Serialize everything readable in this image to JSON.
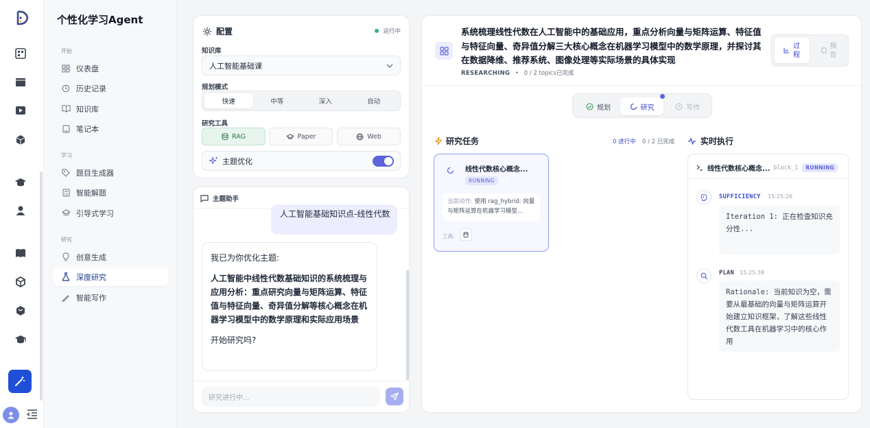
{
  "app": {
    "brand": "个性化学习Agent"
  },
  "rail": {
    "icons": [
      "logo-icon",
      "dashboard-icon",
      "video-icon",
      "play-icon",
      "cube-icon",
      "graduation-icon",
      "user-icon",
      "book-icon",
      "box-icon",
      "package-icon",
      "hat-icon",
      "wand-icon",
      "avatar",
      "collapse-icon"
    ]
  },
  "nav": {
    "sections": [
      {
        "title": "开始",
        "items": [
          {
            "label": "仪表盘",
            "icon": "dashboard-icon"
          },
          {
            "label": "历史记录",
            "icon": "history-icon"
          },
          {
            "label": "知识库",
            "icon": "book-open-icon"
          },
          {
            "label": "笔记本",
            "icon": "notebook-icon"
          }
        ]
      },
      {
        "title": "学习",
        "items": [
          {
            "label": "题目生成器",
            "icon": "tag-icon"
          },
          {
            "label": "智能解题",
            "icon": "calculator-icon"
          },
          {
            "label": "引导式学习",
            "icon": "graduation-icon"
          }
        ]
      },
      {
        "title": "研究",
        "items": [
          {
            "label": "创意生成",
            "icon": "lightbulb-icon"
          },
          {
            "label": "深度研究",
            "icon": "flask-icon",
            "active": true
          },
          {
            "label": "智能写作",
            "icon": "pen-icon"
          }
        ]
      }
    ]
  },
  "config": {
    "title": "配置",
    "status": "运行中",
    "kb_label": "知识库",
    "kb_value": "人工智能基础课",
    "mode_label": "规划模式",
    "modes": [
      "快速",
      "中等",
      "深入",
      "自动"
    ],
    "active_mode": "快速",
    "tools_label": "研究工具",
    "tools": [
      "RAG",
      "Paper",
      "Web"
    ],
    "active_tool": "RAG",
    "topic_opt_label": "主题优化",
    "topic_opt_on": true
  },
  "assistant": {
    "title": "主题助手",
    "user_msg": "人工智能基础知识点-线性代数",
    "ai_intro": "我已为你优化主题:",
    "ai_topic": "人工智能中线性代数基础知识的系统梳理与应用分析：重点研究向量与矩阵运算、特征值与特征向量、奇异值分解等核心概念在机器学习模型中的数学原理和实际应用场景",
    "ai_question": "开始研究吗?",
    "input_placeholder": "研究进行中..."
  },
  "research": {
    "title": "系统梳理线性代数在人工智能中的基础应用，重点分析向量与矩阵运算、特征值与特征向量、奇异值分解三大核心概念在机器学习模型中的数学原理，并探讨其在数据降维、推荐系统、图像处理等实际场景的具体实现",
    "status": "RESEARCHING",
    "progress": "0 / 2 topics已完成",
    "process_btn": "过程",
    "report_btn": "报告",
    "stages": [
      "规划",
      "研究",
      "写作"
    ],
    "active_stage": "研究",
    "tasks_title": "研究任务",
    "tasks_running": "0 进行中",
    "tasks_done": "0 / 2 已完成",
    "task": {
      "name": "线性代数核心概念...",
      "status": "RUNNING",
      "action_label": "当前动作:",
      "action": "使用 rag_hybrid: 向量与矩阵运算在机器学习模型...",
      "tools_label": "工具:"
    },
    "exec_title": "实时执行",
    "exec_header": {
      "name": "线性代数核心概念...",
      "block": "block_1",
      "status": "RUNNING"
    },
    "steps": [
      {
        "type": "SUFFICIENCY",
        "time": "15:25:26",
        "text": "Iteration 1: 正在检查知识充分性..."
      },
      {
        "type": "PLAN",
        "time": "15:25:38",
        "text": "Rationale: 当前知识为空，需要从最基础的向量与矩阵运算开始建立知识框架，了解这些线性代数工具在机器学习中的核心作用"
      }
    ]
  },
  "colors": {
    "accent": "#5b64d8",
    "rail_active": "#1e4fd6",
    "running": "#5b64d8",
    "status_dot": "#34b27b"
  }
}
